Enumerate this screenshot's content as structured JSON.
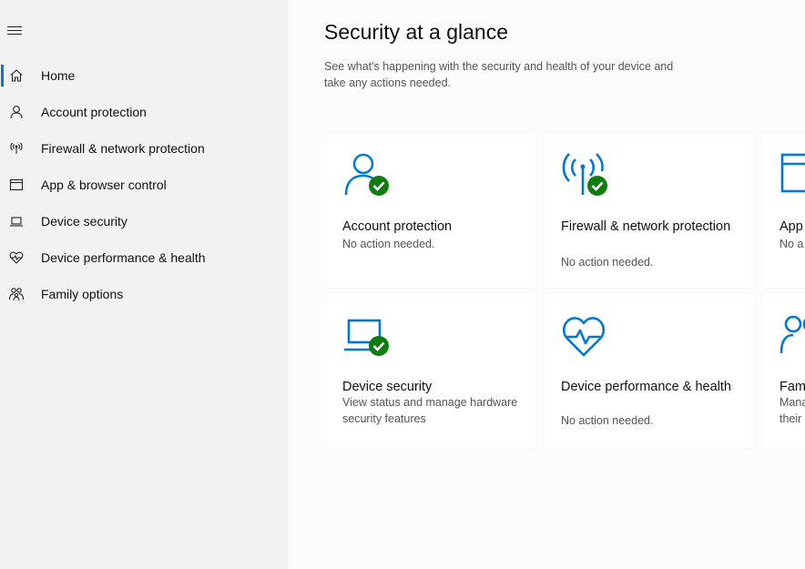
{
  "sidebar": {
    "menu_icon": "hamburger-menu-icon",
    "items": [
      {
        "label": "Home",
        "icon": "home-icon",
        "active": true
      },
      {
        "label": "Account protection",
        "icon": "person-icon"
      },
      {
        "label": "Firewall & network protection",
        "icon": "antenna-icon"
      },
      {
        "label": "App & browser control",
        "icon": "browser-window-icon"
      },
      {
        "label": "Device security",
        "icon": "laptop-icon"
      },
      {
        "label": "Device performance & health",
        "icon": "heart-pulse-icon"
      },
      {
        "label": "Family options",
        "icon": "family-icon"
      }
    ]
  },
  "main": {
    "title": "Security at a glance",
    "subtitle": "See what's happening with the security and health of your device and take any actions needed.",
    "tiles": [
      {
        "title": "Account protection",
        "status": "No action needed.",
        "icon": "person-check-icon"
      },
      {
        "title": "Firewall & network protection",
        "status": "No action needed.",
        "icon": "antenna-check-icon"
      },
      {
        "title": "App",
        "status": "No a",
        "icon": "browser-window-icon"
      },
      {
        "title": "Device security",
        "status": "View status and manage hardware security features",
        "icon": "laptop-check-icon"
      },
      {
        "title": "Device performance & health",
        "status": "No action needed.",
        "icon": "heart-pulse-icon"
      },
      {
        "title": "Fam",
        "status": "Mana their",
        "icon": "family-icon"
      }
    ]
  },
  "colors": {
    "accent": "#0078d4",
    "ok": "#107c10",
    "sidebar_bg": "#f2f2f2"
  }
}
